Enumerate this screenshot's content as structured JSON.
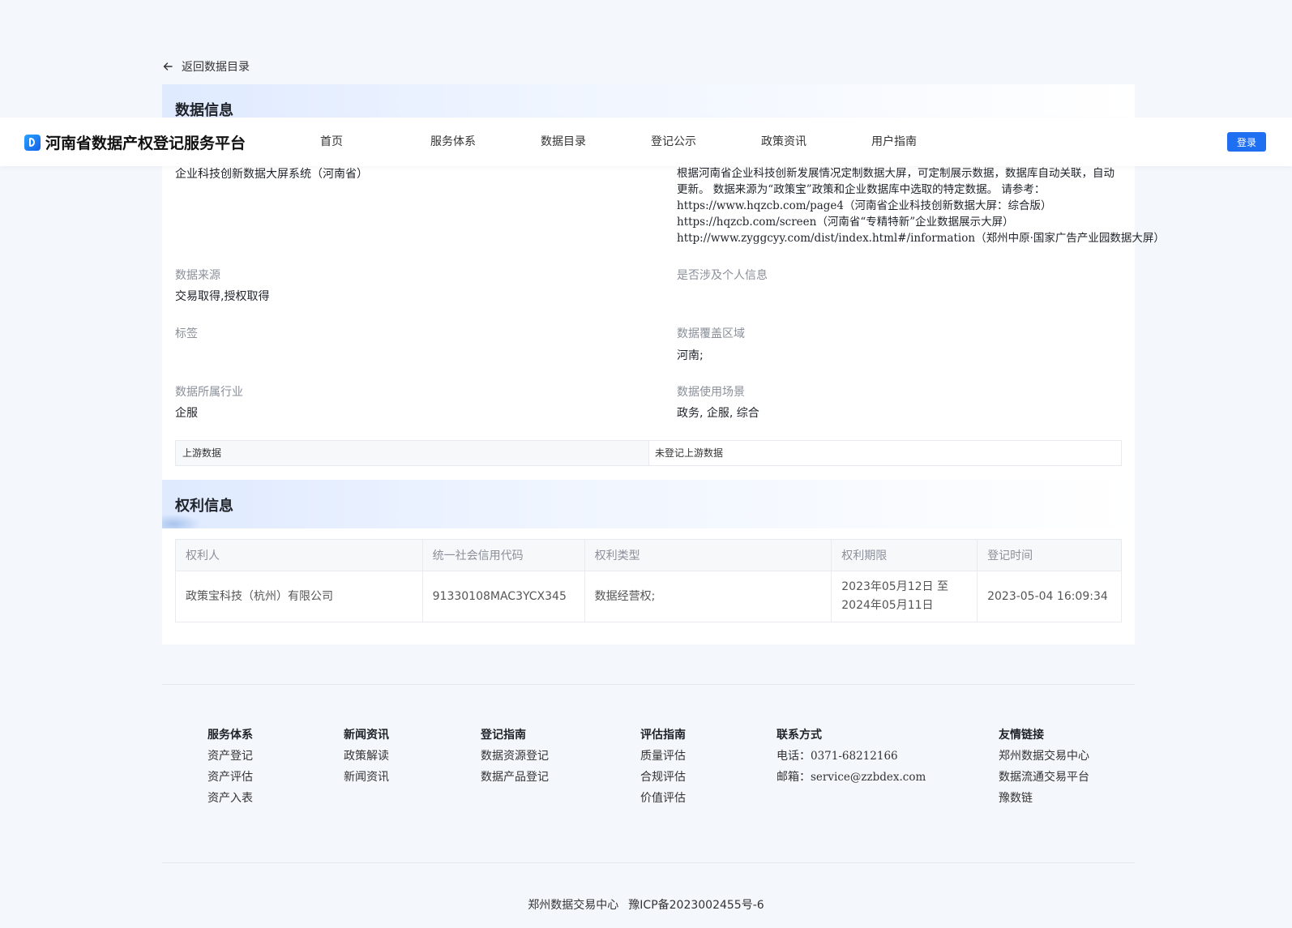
{
  "back": {
    "label": "返回数据目录"
  },
  "header": {
    "logo_text": "河南省数据产权登记服务平台",
    "nav": [
      "首页",
      "服务体系",
      "数据目录",
      "登记公示",
      "政策资讯",
      "用户指南"
    ],
    "login_label": "登录"
  },
  "data_info": {
    "title": "数据信息",
    "name_value": "企业科技创新数据大屏系统（河南省）",
    "description_lines": [
      "根据河南省企业科技创新发展情况定制数据大屏，可定制展示数据，数据库自动关联，自动更新。 数据来源为“政策宝”政策和企业数据库中选取的特定数据。 请参考：",
      "https://www.hqzcb.com/page4（河南省企业科技创新数据大屏：综合版）",
      "https://hqzcb.com/screen（河南省“专精特新”企业数据展示大屏）",
      "http://www.zyggcyy.com/dist/index.html#/information（郑州中原·国家广告产业园数据大屏）"
    ],
    "fields": {
      "source_label": "数据来源",
      "source_value": "交易取得,授权取得",
      "personal_label": "是否涉及个人信息",
      "personal_value": "",
      "tags_label": "标签",
      "tags_value": "",
      "region_label": "数据覆盖区域",
      "region_value": "河南;",
      "industry_label": "数据所属行业",
      "industry_value": "企服",
      "scene_label": "数据使用场景",
      "scene_value": "政务, 企服, 综合"
    },
    "upstream": {
      "label": "上游数据",
      "value": "未登记上游数据"
    }
  },
  "rights_info": {
    "title": "权利信息",
    "columns": [
      "权利人",
      "统一社会信用代码",
      "权利类型",
      "权利期限",
      "登记时间"
    ],
    "rows": [
      {
        "holder": "政策宝科技（杭州）有限公司",
        "credit_code": "91330108MAC3YCX345",
        "right_type": "数据经营权;",
        "term_start": "2023年05月12日 至",
        "term_end": "2024年05月11日",
        "registered_at": "2023-05-04 16:09:34"
      }
    ]
  },
  "footer": {
    "service": {
      "title": "服务体系",
      "items": [
        "资产登记",
        "资产评估",
        "资产入表"
      ]
    },
    "news": {
      "title": "新闻资讯",
      "items": [
        "政策解读",
        "新闻资讯"
      ]
    },
    "register_guide": {
      "title": "登记指南",
      "items": [
        "数据资源登记",
        "数据产品登记"
      ]
    },
    "evaluate_guide": {
      "title": "评估指南",
      "items": [
        "质量评估",
        "合规评估",
        "价值评估"
      ]
    },
    "contact": {
      "title": "联系方式",
      "phone_label": "电话：",
      "phone": "0371-68212166",
      "email_label": "邮箱：",
      "email": "service@zzbdex.com"
    },
    "links": {
      "title": "友情链接",
      "items": [
        "郑州数据交易中心",
        "数据流通交易平台",
        "豫数链"
      ]
    },
    "copyright_org": "郑州数据交易中心",
    "icp": "豫ICP备2023002455号-6"
  },
  "colors": {
    "accent": "#1e6ff1",
    "page_bg": "#f4f7fc",
    "label": "#8a8f99"
  }
}
